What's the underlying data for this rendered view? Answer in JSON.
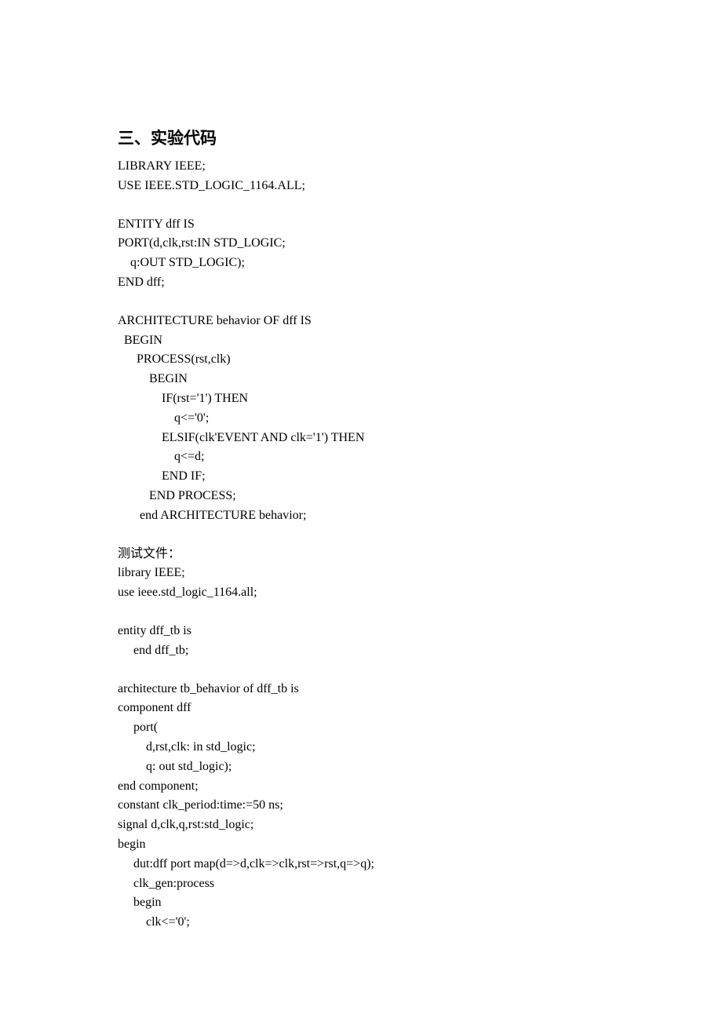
{
  "heading": "三、实验代码",
  "lines": [
    "LIBRARY IEEE;",
    "USE IEEE.STD_LOGIC_1164.ALL;",
    "",
    "ENTITY dff IS",
    "PORT(d,clk,rst:IN STD_LOGIC;",
    "    q:OUT STD_LOGIC);",
    "END dff;",
    "",
    "ARCHITECTURE behavior OF dff IS",
    "  BEGIN",
    "      PROCESS(rst,clk)",
    "          BEGIN",
    "              IF(rst='1') THEN",
    "                  q<='0';",
    "              ELSIF(clk'EVENT AND clk='1') THEN",
    "                  q<=d;",
    "              END IF;",
    "          END PROCESS;",
    "       end ARCHITECTURE behavior;",
    "",
    "测试文件：",
    "library IEEE;",
    "use ieee.std_logic_1164.all;",
    "",
    "entity dff_tb is",
    "     end dff_tb;",
    "",
    "architecture tb_behavior of dff_tb is",
    "component dff",
    "     port(",
    "         d,rst,clk: in std_logic;",
    "         q: out std_logic);",
    "end component;",
    "constant clk_period:time:=50 ns;",
    "signal d,clk,q,rst:std_logic;",
    "begin",
    "     dut:dff port map(d=>d,clk=>clk,rst=>rst,q=>q);",
    "     clk_gen:process",
    "     begin",
    "         clk<='0';"
  ]
}
